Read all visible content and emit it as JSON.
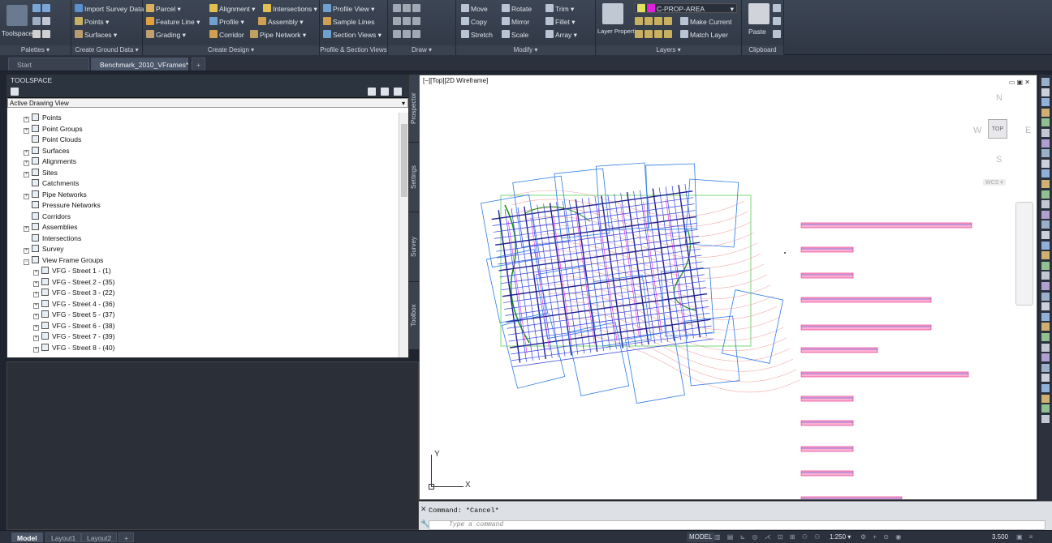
{
  "ribbon": {
    "toolspace_label": "Toolspace",
    "panels": {
      "palettes": "Palettes ▾",
      "create_ground_data": "Create Ground Data ▾",
      "create_design": "Create Design ▾",
      "profile_section_views": "Profile & Section Views",
      "draw": "Draw ▾",
      "modify": "Modify ▾",
      "layers": "Layers ▾",
      "clipboard": "Clipboard"
    },
    "buttons": {
      "import_survey_data": "Import Survey Data",
      "points": "Points ▾",
      "surfaces": "Surfaces ▾",
      "parcel": "Parcel ▾",
      "feature_line": "Feature Line ▾",
      "grading": "Grading ▾",
      "alignment": "Alignment ▾",
      "intersections": "Intersections ▾",
      "profile": "Profile ▾",
      "assembly": "Assembly ▾",
      "corridor": "Corridor",
      "pipe_network": "Pipe Network ▾",
      "profile_view": "Profile View ▾",
      "sample_lines": "Sample Lines",
      "section_views": "Section Views ▾",
      "move": "Move",
      "rotate": "Rotate",
      "trim": "Trim ▾",
      "copy": "Copy",
      "mirror": "Mirror",
      "fillet": "Fillet ▾",
      "stretch": "Stretch",
      "scale": "Scale",
      "array": "Array ▾",
      "layer_properties": "Layer Properties",
      "layer_name": "C-PROP-AREA",
      "make_current": "Make Current",
      "match_layer": "Match Layer",
      "paste": "Paste"
    },
    "colors": {
      "layer_swatch": "#e020e0"
    }
  },
  "doc_tabs": {
    "start": "Start",
    "active": "Benchmark_2010_VFrames*",
    "close": "✕",
    "add": "+"
  },
  "toolspace": {
    "title": "TOOLSPACE",
    "view_select": "Active Drawing View",
    "side_tabs": [
      "Prospector",
      "Settings",
      "Survey",
      "Toolbox"
    ],
    "tree": [
      {
        "label": "Points",
        "level": 1,
        "expand": "+"
      },
      {
        "label": "Point Groups",
        "level": 1,
        "expand": "+"
      },
      {
        "label": "Point Clouds",
        "level": 1,
        "expand": ""
      },
      {
        "label": "Surfaces",
        "level": 1,
        "expand": "+"
      },
      {
        "label": "Alignments",
        "level": 1,
        "expand": "+"
      },
      {
        "label": "Sites",
        "level": 1,
        "expand": "+"
      },
      {
        "label": "Catchments",
        "level": 1,
        "expand": ""
      },
      {
        "label": "Pipe Networks",
        "level": 1,
        "expand": "+"
      },
      {
        "label": "Pressure Networks",
        "level": 1,
        "expand": ""
      },
      {
        "label": "Corridors",
        "level": 1,
        "expand": ""
      },
      {
        "label": "Assemblies",
        "level": 1,
        "expand": "+"
      },
      {
        "label": "Intersections",
        "level": 1,
        "expand": ""
      },
      {
        "label": "Survey",
        "level": 1,
        "expand": "+"
      },
      {
        "label": "View Frame Groups",
        "level": 1,
        "expand": "−"
      },
      {
        "label": "VFG - Street 1 - (1)",
        "level": 2,
        "expand": "+"
      },
      {
        "label": "VFG - Street 2 - (35)",
        "level": 2,
        "expand": "+"
      },
      {
        "label": "VFG - Street 3 - (22)",
        "level": 2,
        "expand": "+"
      },
      {
        "label": "VFG - Street 4 - (36)",
        "level": 2,
        "expand": "+"
      },
      {
        "label": "VFG - Street 5 - (37)",
        "level": 2,
        "expand": "+"
      },
      {
        "label": "VFG - Street 6 - (38)",
        "level": 2,
        "expand": "+"
      },
      {
        "label": "VFG - Street 7 - (39)",
        "level": 2,
        "expand": "+"
      },
      {
        "label": "VFG - Street 8 - (40)",
        "level": 2,
        "expand": "+"
      }
    ]
  },
  "viewport": {
    "label": "[−][Top][2D Wireframe]",
    "compass": {
      "n": "N",
      "s": "S",
      "e": "E",
      "w": "W",
      "top": "TOP",
      "wcs": "WCS ▾"
    },
    "ucs": {
      "x": "X",
      "y": "Y"
    }
  },
  "command": {
    "history": "Command: *Cancel*",
    "placeholder": "Type a command"
  },
  "layout_tabs": [
    "Model",
    "Layout1",
    "Layout2",
    "+"
  ],
  "status": {
    "model": "MODEL",
    "scale": "1:250 ▾",
    "value": "3.500"
  }
}
